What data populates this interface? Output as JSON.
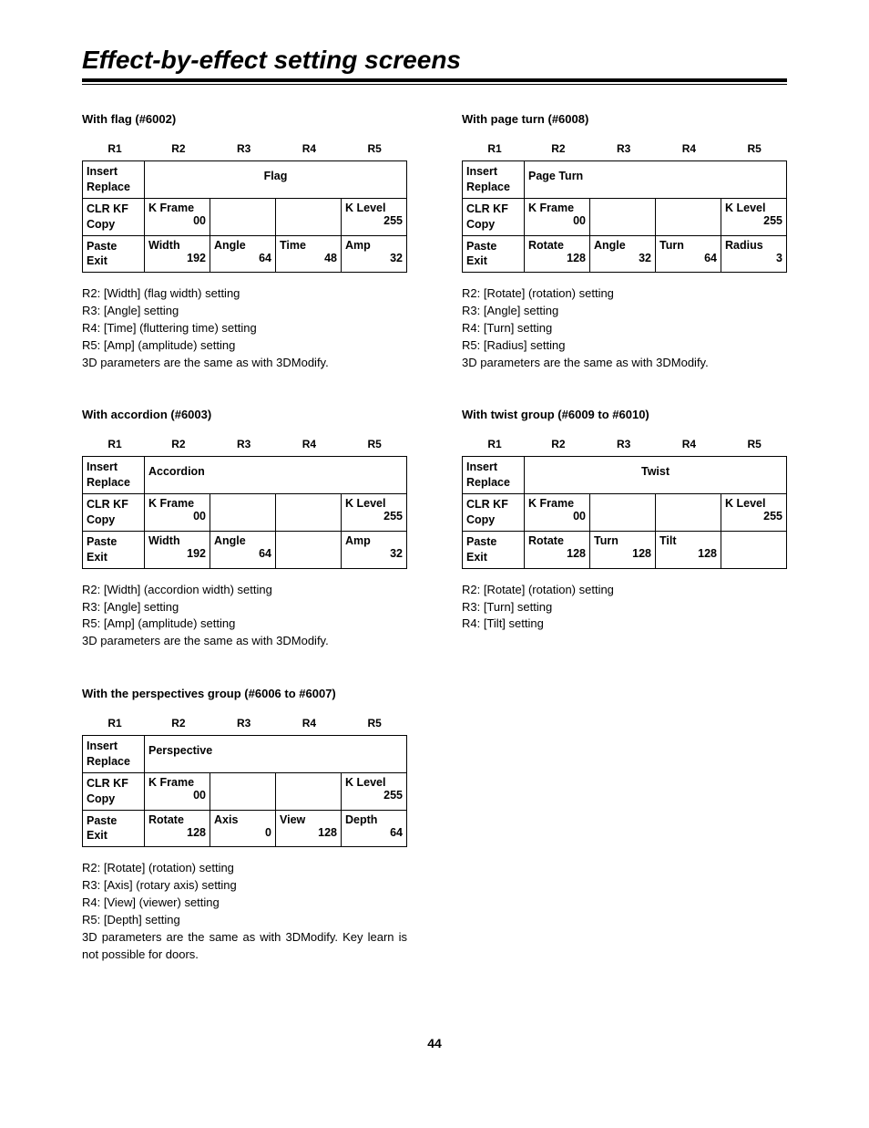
{
  "title": "Effect-by-effect setting screens",
  "page_number": "44",
  "headers": {
    "r1": "R1",
    "r2": "R2",
    "r3": "R3",
    "r4": "R4",
    "r5": "R5"
  },
  "side": {
    "row1a": "Insert",
    "row1b": "Replace",
    "row2a": "CLR KF",
    "row2b": "Copy",
    "row3a": "Paste",
    "row3b": "Exit"
  },
  "sections": {
    "flag": {
      "title": "With flag (#6002)",
      "name": "Flag",
      "row2": {
        "c1l": "K Frame",
        "c1v": "00",
        "c4l": "K Level",
        "c4v": "255"
      },
      "row3": {
        "c1l": "Width",
        "c1v": "192",
        "c2l": "Angle",
        "c2v": "64",
        "c3l": "Time",
        "c3v": "48",
        "c4l": "Amp",
        "c4v": "32"
      },
      "notes": [
        "R2: [Width] (flag width) setting",
        "R3: [Angle] setting",
        "R4: [Time] (fluttering time) setting",
        "R5: [Amp] (amplitude) setting",
        "3D parameters are the same as with 3DModify."
      ]
    },
    "accordion": {
      "title": "With accordion (#6003)",
      "name": "Accordion",
      "row2": {
        "c1l": "K Frame",
        "c1v": "00",
        "c4l": "K Level",
        "c4v": "255"
      },
      "row3": {
        "c1l": "Width",
        "c1v": "192",
        "c2l": "Angle",
        "c2v": "64",
        "c4l": "Amp",
        "c4v": "32"
      },
      "notes": [
        "R2: [Width] (accordion width) setting",
        "R3: [Angle] setting",
        "R5: [Amp] (amplitude) setting",
        "3D parameters are the same as with 3DModify."
      ]
    },
    "perspective": {
      "title": "With the perspectives group (#6006 to #6007)",
      "name": "Perspective",
      "row2": {
        "c1l": "K Frame",
        "c1v": "00",
        "c4l": "K Level",
        "c4v": "255"
      },
      "row3": {
        "c1l": "Rotate",
        "c1v": "128",
        "c2l": "Axis",
        "c2v": "0",
        "c3l": "View",
        "c3v": "128",
        "c4l": "Depth",
        "c4v": "64"
      },
      "notes": [
        "R2: [Rotate] (rotation) setting",
        "R3: [Axis] (rotary axis) setting",
        "R4: [View] (viewer) setting",
        "R5: [Depth] setting",
        "3D parameters are the same as with 3DModify.  Key learn is not possible for doors."
      ]
    },
    "pageturn": {
      "title": "With page turn (#6008)",
      "name": "Page Turn",
      "row2": {
        "c1l": "K Frame",
        "c1v": "00",
        "c4l": "K Level",
        "c4v": "255"
      },
      "row3": {
        "c1l": "Rotate",
        "c1v": "128",
        "c2l": "Angle",
        "c2v": "32",
        "c3l": "Turn",
        "c3v": "64",
        "c4l": "Radius",
        "c4v": "3"
      },
      "notes": [
        "R2: [Rotate] (rotation) setting",
        "R3: [Angle] setting",
        "R4: [Turn] setting",
        "R5: [Radius] setting",
        "3D parameters are the same as with 3DModify."
      ]
    },
    "twist": {
      "title": "With twist group (#6009 to #6010)",
      "name": "Twist",
      "row2": {
        "c1l": "K Frame",
        "c1v": "00",
        "c4l": "K Level",
        "c4v": "255"
      },
      "row3": {
        "c1l": "Rotate",
        "c1v": "128",
        "c2l": "Turn",
        "c2v": "128",
        "c3l": "Tilt",
        "c3v": "128"
      },
      "notes": [
        "R2: [Rotate] (rotation) setting",
        "R3: [Turn] setting",
        "R4: [Tilt] setting"
      ]
    }
  }
}
